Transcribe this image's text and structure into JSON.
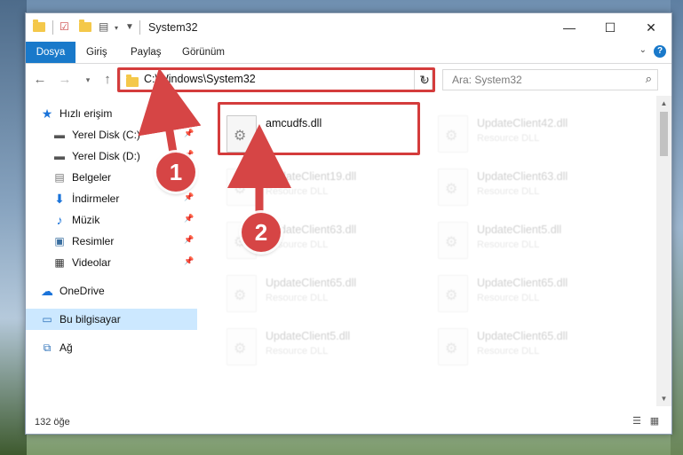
{
  "window": {
    "title": "System32"
  },
  "ribbon": {
    "tabs": [
      "Dosya",
      "Giriş",
      "Paylaş",
      "Görünüm"
    ],
    "help": "?"
  },
  "navigation": {
    "address": "C:\\Windows\\System32",
    "search_placeholder": "Ara: System32"
  },
  "sidebar": {
    "quick_access": "Hızlı erişim",
    "items": [
      {
        "label": "Yerel Disk (C:)",
        "icon": "drive-icon"
      },
      {
        "label": "Yerel Disk (D:)",
        "icon": "drive-icon"
      },
      {
        "label": "Belgeler",
        "icon": "documents-icon"
      },
      {
        "label": "İndirmeler",
        "icon": "download-icon"
      },
      {
        "label": "Müzik",
        "icon": "music-icon"
      },
      {
        "label": "Resimler",
        "icon": "pictures-icon"
      },
      {
        "label": "Videolar",
        "icon": "videos-icon"
      }
    ],
    "onedrive": "OneDrive",
    "this_pc": "Bu bilgisayar",
    "network": "Ağ"
  },
  "files": {
    "highlighted": {
      "name": "amcudfs.dll",
      "type": ""
    },
    "faded_left": [
      {
        "name": "UpdateClient19.dll",
        "type": "Resource DLL"
      },
      {
        "name": "UpdateClient63.dll",
        "type": "Resource DLL"
      },
      {
        "name": "UpdateClient65.dll",
        "type": "Resource DLL"
      },
      {
        "name": "UpdateClient5.dll",
        "type": "Resource DLL"
      }
    ],
    "faded_right": [
      {
        "name": "UpdateClient42.dll",
        "type": "Resource DLL"
      },
      {
        "name": "UpdateClient63.dll",
        "type": "Resource DLL"
      },
      {
        "name": "UpdateClient5.dll",
        "type": "Resource DLL"
      },
      {
        "name": "UpdateClient65.dll",
        "type": "Resource DLL"
      },
      {
        "name": "UpdateClient65.dll",
        "type": "Resource DLL"
      }
    ]
  },
  "status": {
    "count": "132 öğe"
  },
  "annotations": {
    "step1": "1",
    "step2": "2",
    "highlight_color": "#d43c3c"
  }
}
